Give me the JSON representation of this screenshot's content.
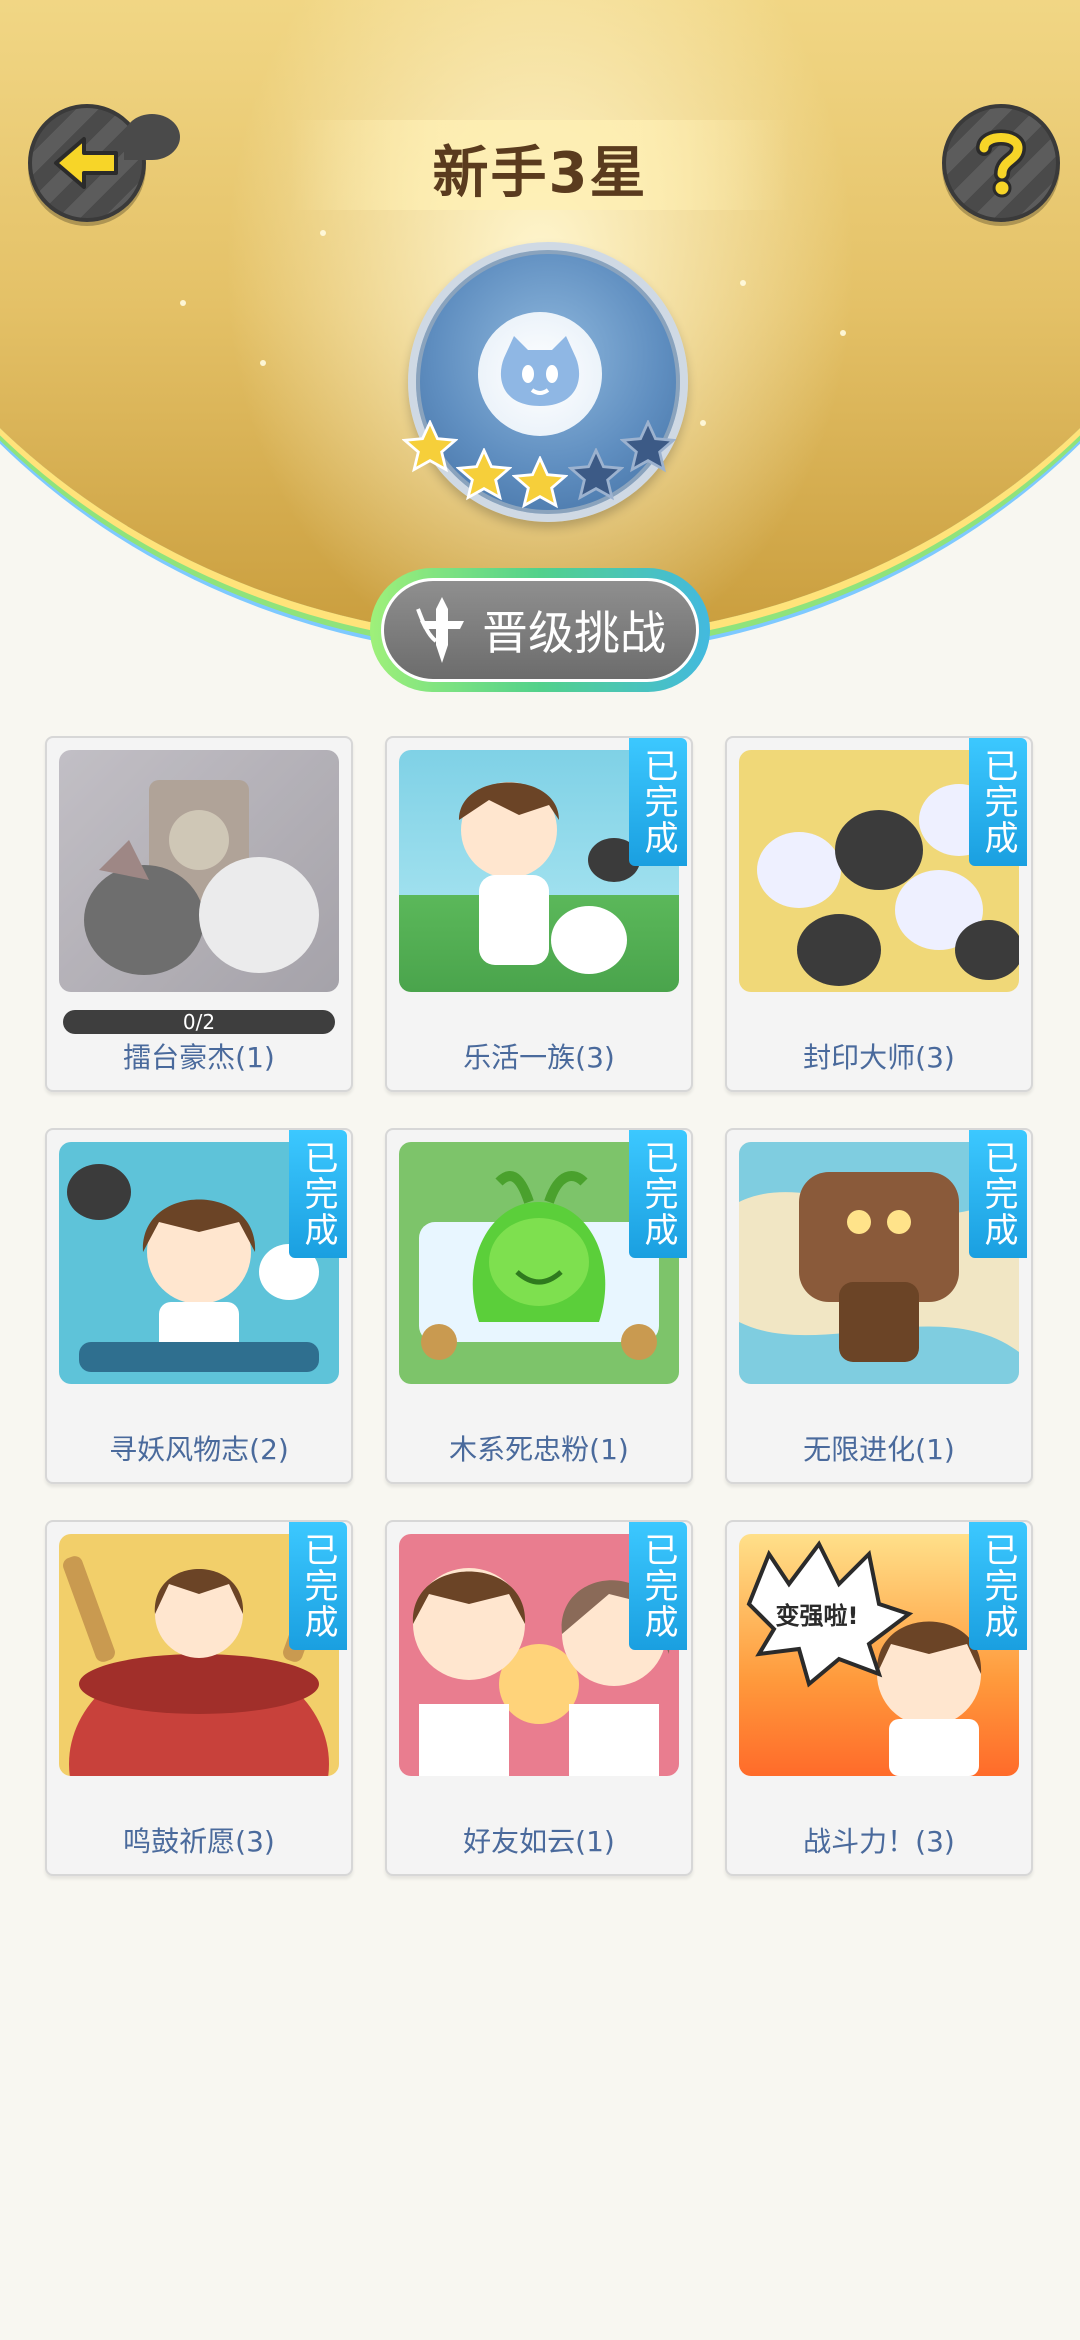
{
  "header": {
    "title": "新手3星",
    "back_icon": "arrow-left-icon",
    "help_icon": "question-icon",
    "badge": {
      "icon": "spirit-face-icon",
      "stars_earned": 3,
      "stars_total": 5
    }
  },
  "promote": {
    "label": "晋级挑战",
    "icon": "sword-icon"
  },
  "cards": [
    {
      "label": "擂台豪杰(1)",
      "completed": false,
      "progress": "0/2"
    },
    {
      "label": "乐活一族(3)",
      "completed": true,
      "badge": "已完成"
    },
    {
      "label": "封印大师(3)",
      "completed": true,
      "badge": "已完成"
    },
    {
      "label": "寻妖风物志(2)",
      "completed": true,
      "badge": "已完成"
    },
    {
      "label": "木系死忠粉(1)",
      "completed": true,
      "badge": "已完成"
    },
    {
      "label": "无限进化(1)",
      "completed": true,
      "badge": "已完成"
    },
    {
      "label": "鸣鼓祈愿(3)",
      "completed": true,
      "badge": "已完成"
    },
    {
      "label": "好友如云(1)",
      "completed": true,
      "badge": "已完成"
    },
    {
      "label": "战斗力！(3)",
      "completed": true,
      "badge": "已完成",
      "image_text": "变强啦!"
    }
  ],
  "colors": {
    "accent": "#1a9fe0",
    "label": "#4a6a9c",
    "header_gold": "#e6c566"
  }
}
